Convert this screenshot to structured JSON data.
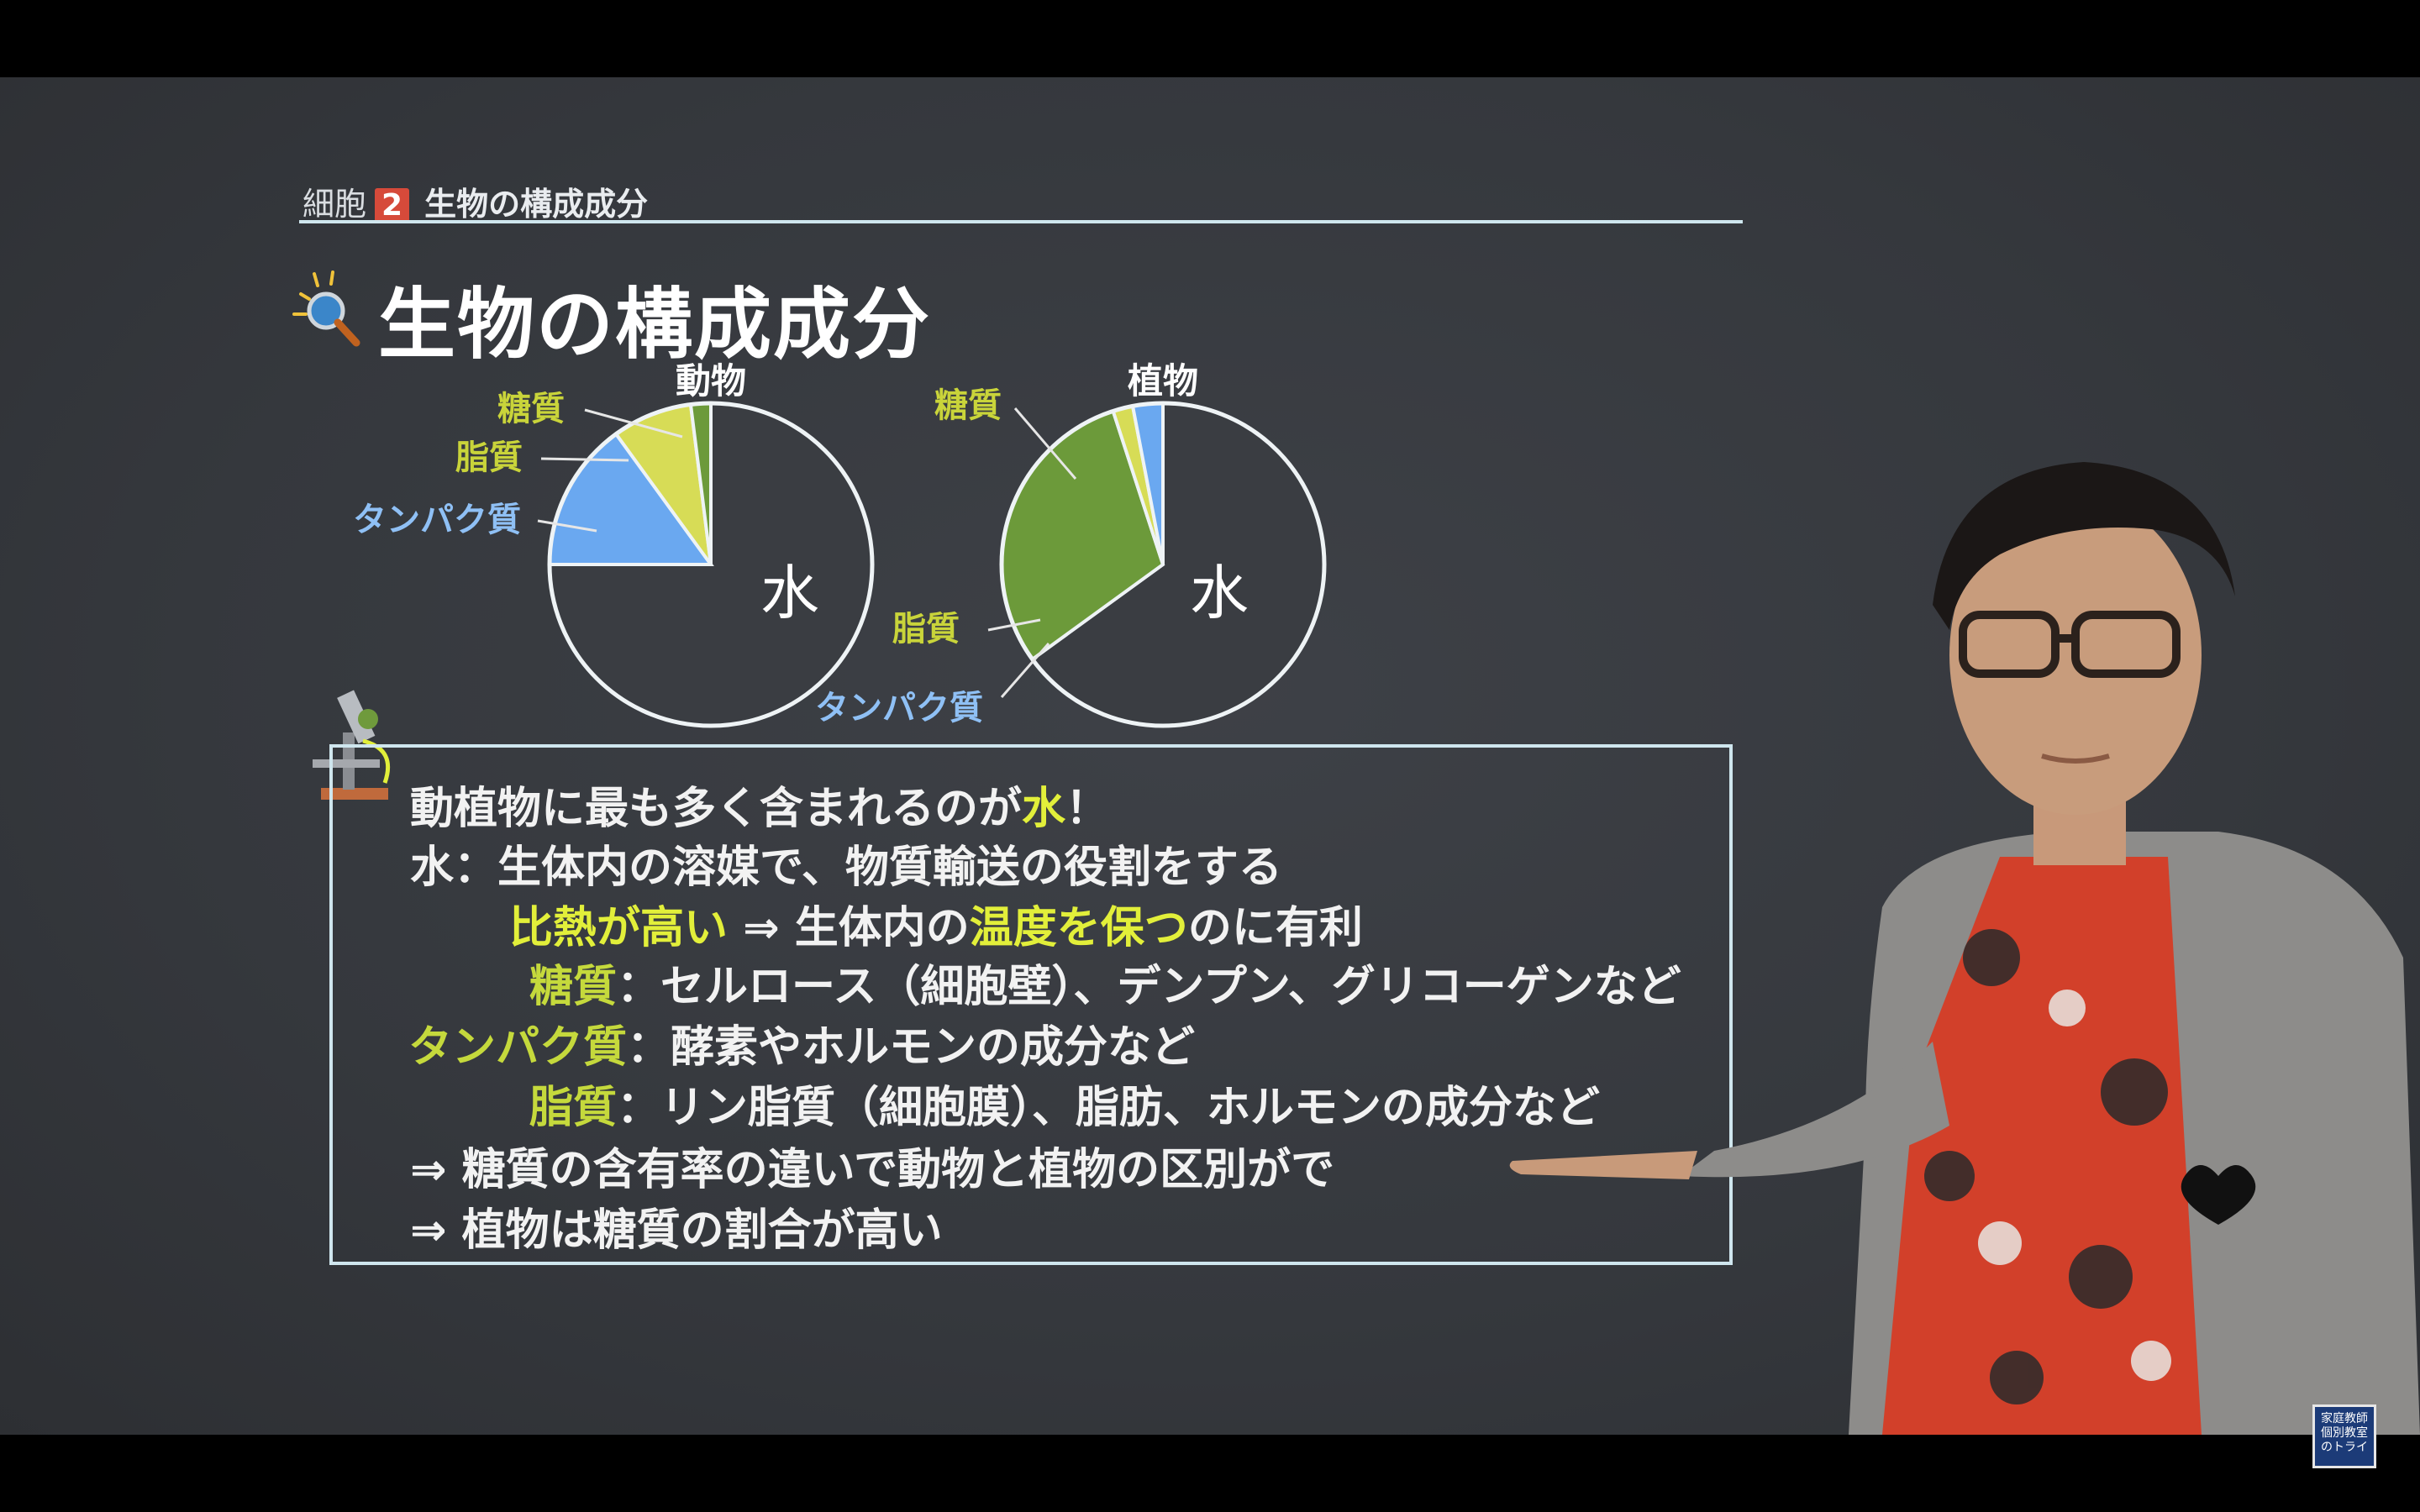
{
  "header": {
    "section": "細胞",
    "section_number": "2",
    "section_title": "生物の構成成分"
  },
  "title": "生物の構成成分",
  "chart_data": [
    {
      "type": "pie",
      "title": "動物",
      "categories": [
        "水",
        "タンパク質",
        "脂質",
        "糖質"
      ],
      "values": [
        75,
        15,
        8,
        2
      ],
      "colors": [
        "#3a3d42",
        "#6aa8f0",
        "#d7dc56",
        "#6c9a3a"
      ],
      "labels": {
        "water": "水",
        "protein": "タンパク質",
        "lipid": "脂質",
        "sugar": "糖質"
      }
    },
    {
      "type": "pie",
      "title": "植物",
      "categories": [
        "水",
        "糖質",
        "脂質",
        "タンパク質"
      ],
      "values": [
        65,
        30,
        2,
        3
      ],
      "colors": [
        "#3a3d42",
        "#6c9a3a",
        "#d7dc56",
        "#6aa8f0"
      ],
      "labels": {
        "water": "水",
        "protein": "タンパク質",
        "lipid": "脂質",
        "sugar": "糖質"
      }
    }
  ],
  "notes": {
    "line1_pre": "動植物に最も多く含まれるのが",
    "line1_hl": "水",
    "line1_post": "！",
    "line2": "水：生体内の溶媒で、物質輸送の役割をする",
    "line3_hl1": "比熱が高い",
    "line3_mid": " ⇒ 生体内の",
    "line3_hl2": "温度を保つ",
    "line3_post": "のに有利",
    "line4_hl": "糖質",
    "line4_post": "：セルロース（細胞壁）、デンプン、グリコーゲンなど",
    "line5_hl": "タンパク質",
    "line5_post": "：酵素やホルモンの成分など",
    "line6_hl": "脂質",
    "line6_post": "：リン脂質（細胞膜）、脂肪、ホルモンの成分など",
    "line7": "⇒ 糖質の含有率の違いで動物と植物の区別がで",
    "line8": "⇒ 植物は糖質の割合が高い"
  },
  "logo": {
    "line1": "家庭教師",
    "line2": "個別教室",
    "line3": "のトライ"
  }
}
